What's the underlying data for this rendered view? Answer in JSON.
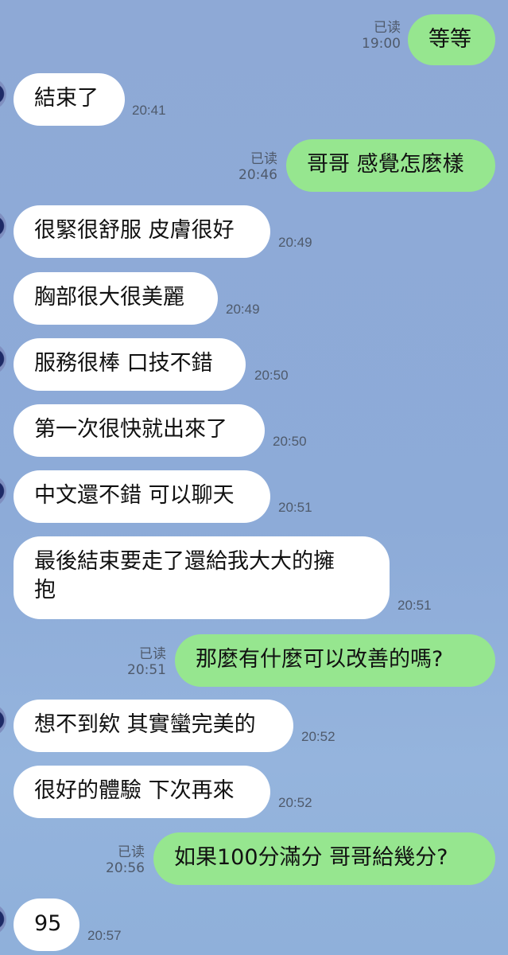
{
  "chat": {
    "messages": [
      {
        "side": "out",
        "text": "等等",
        "read": "已读",
        "time": "19:00"
      },
      {
        "side": "in",
        "text": "結束了",
        "time": "20:41"
      },
      {
        "side": "out",
        "text": "哥哥 感覺怎麽樣",
        "read": "已读",
        "time": "20:46"
      },
      {
        "side": "in",
        "text": "很緊很舒服 皮膚很好",
        "time": "20:49"
      },
      {
        "side": "in",
        "text": "胸部很大很美麗",
        "time": "20:49"
      },
      {
        "side": "in",
        "text": "服務很棒 口技不錯",
        "time": "20:50"
      },
      {
        "side": "in",
        "text": "第一次很快就出來了",
        "time": "20:50"
      },
      {
        "side": "in",
        "text": "中文還不錯 可以聊天",
        "time": "20:51"
      },
      {
        "side": "in",
        "text": "最後結束要走了還給我大大的擁\n抱",
        "time": "20:51"
      },
      {
        "side": "out",
        "text": "那麼有什麼可以改善的嗎?",
        "read": "已读",
        "time": "20:51"
      },
      {
        "side": "in",
        "text": "想不到欸 其實蠻完美的",
        "time": "20:52"
      },
      {
        "side": "in",
        "text": "很好的體驗 下次再來",
        "time": "20:52"
      },
      {
        "side": "out",
        "text": "如果100分滿分 哥哥給幾分?",
        "read": "已读",
        "time": "20:56"
      },
      {
        "side": "in",
        "text": "95",
        "time": "20:57"
      }
    ]
  }
}
